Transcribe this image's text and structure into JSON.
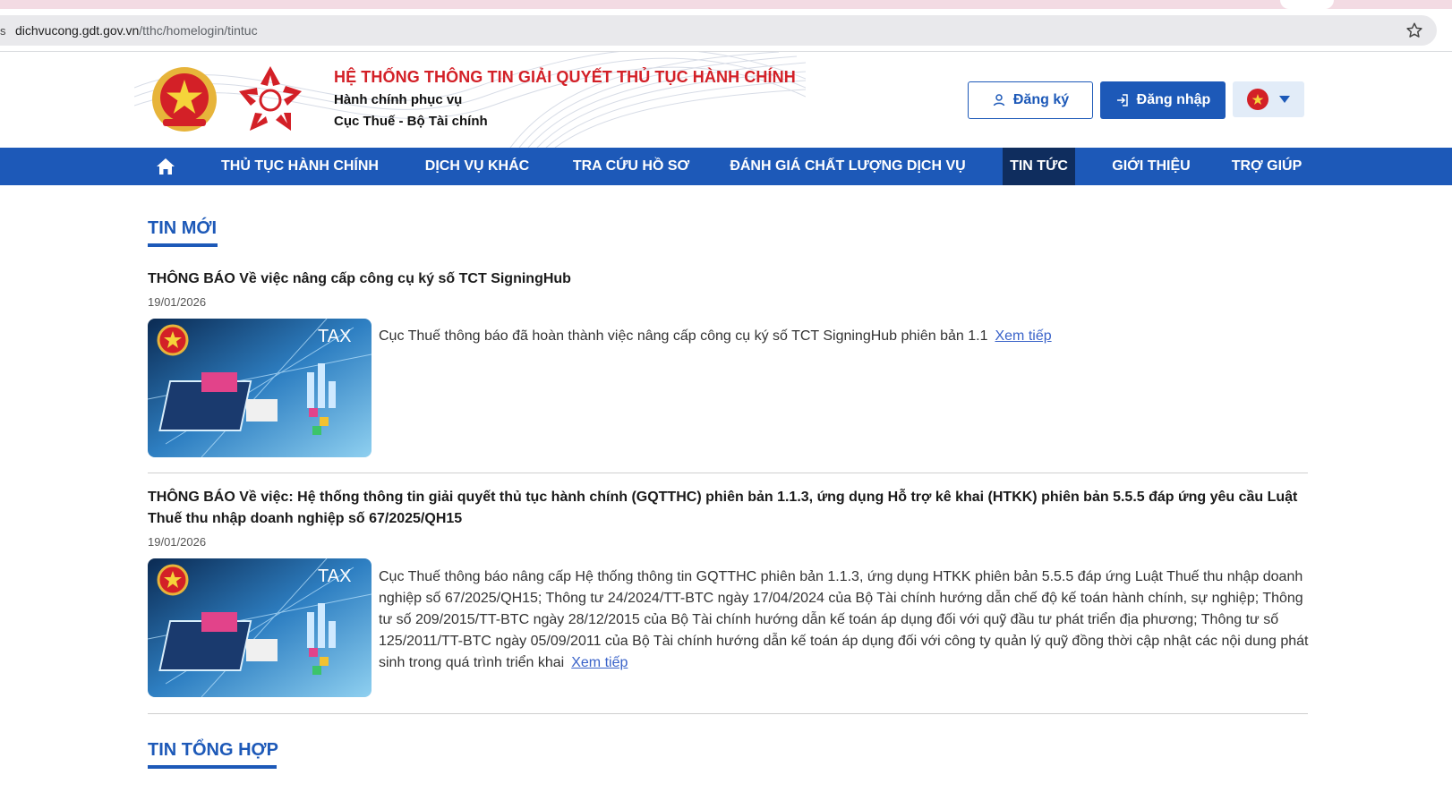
{
  "browser": {
    "url_domain": "dichvucong.gdt.gov.vn",
    "url_path": "/tthc/homelogin/tintuc",
    "leading_char": "s"
  },
  "header": {
    "system_title": "HỆ THỐNG THÔNG TIN GIẢI QUYẾT THỦ TỤC HÀNH CHÍNH",
    "subtitle_1": "Hành chính phục vụ",
    "subtitle_2": "Cục Thuế - Bộ Tài chính",
    "register_label": "Đăng ký",
    "login_label": "Đăng nhập",
    "language": "vi"
  },
  "nav": {
    "home_icon": "home-icon",
    "items": [
      {
        "label": "THỦ TỤC HÀNH CHÍNH"
      },
      {
        "label": "DỊCH VỤ KHÁC"
      },
      {
        "label": "TRA CỨU HỒ SƠ"
      },
      {
        "label": "ĐÁNH GIÁ CHẤT LƯỢNG DỊCH VỤ"
      },
      {
        "label": "TIN TỨC",
        "active": true
      },
      {
        "label": "GIỚI THIỆU"
      },
      {
        "label": "TRỢ GIÚP"
      }
    ]
  },
  "sections": {
    "latest_title": "TIN MỚI",
    "general_title": "TIN TỔNG HỢP"
  },
  "news": [
    {
      "title": "THÔNG BÁO Về việc nâng cấp công cụ ký số TCT SigningHub",
      "date": "19/01/2026",
      "summary": "Cục Thuế thông báo đã hoàn thành việc nâng cấp công cụ ký số TCT SigningHub phiên bản 1.1",
      "more_label": "Xem tiếp",
      "thumb_text": "TAX"
    },
    {
      "title": "THÔNG BÁO Về việc: Hệ thống thông tin giải quyết thủ tục hành chính (GQTTHC) phiên bản 1.1.3, ứng dụng Hỗ trợ kê khai (HTKK) phiên bản 5.5.5 đáp ứng yêu cầu Luật Thuế thu nhập doanh nghiệp số 67/2025/QH15",
      "date": "19/01/2026",
      "summary": "Cục Thuế thông báo nâng cấp Hệ thống thông tin GQTTHC phiên bản 1.1.3, ứng dụng HTKK phiên bản 5.5.5 đáp ứng Luật Thuế thu nhập doanh nghiệp số 67/2025/QH15; Thông tư 24/2024/TT-BTC ngày 17/04/2024 của Bộ Tài chính hướng dẫn chế độ kế toán hành chính, sự nghiệp; Thông tư số 209/2015/TT-BTC ngày 28/12/2015 của Bộ Tài chính hướng dẫn kế toán áp dụng đối với quỹ đầu tư phát triển địa phương; Thông tư số 125/2011/TT-BTC ngày 05/09/2011 của Bộ Tài chính hướng dẫn kế toán áp dụng đối với công ty quản lý quỹ đồng thời cập nhật các nội dung phát sinh trong quá trình triển khai",
      "more_label": "Xem tiếp",
      "thumb_text": "TAX"
    }
  ],
  "colors": {
    "brand_blue": "#1d59b8",
    "nav_active": "#0f2d5e",
    "title_red": "#d32027",
    "link_blue": "#3a63c9"
  }
}
